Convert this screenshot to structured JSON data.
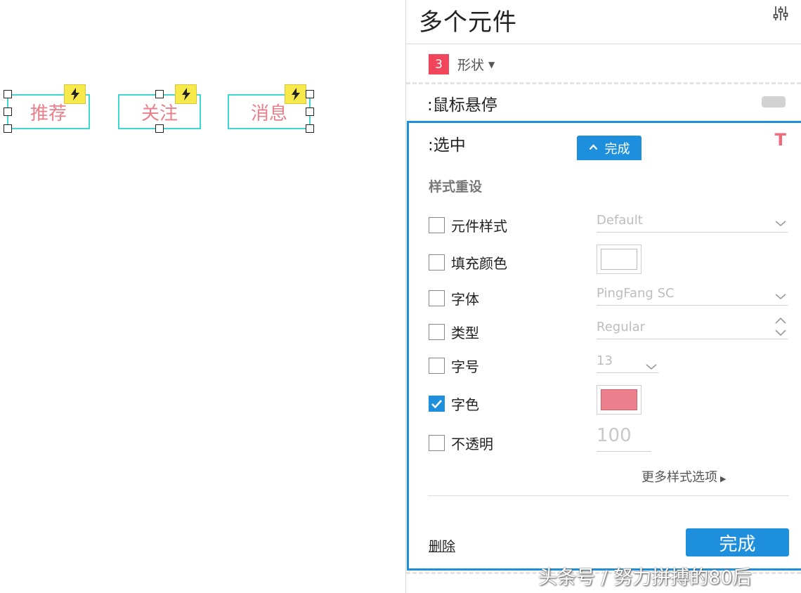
{
  "canvas": {
    "widgets": [
      {
        "label": "推荐"
      },
      {
        "label": "关注"
      },
      {
        "label": "消息"
      }
    ],
    "interaction_icon": "lightning-icon"
  },
  "panel": {
    "title": "多个元件",
    "settings_icon": "sliders-icon",
    "selection_count": "3",
    "shape_label": "形状",
    "hover_state_label": ":鼠标悬停",
    "selected_state_label": ":选中",
    "done_tab_label": "完成",
    "style_reset_title": "样式重设",
    "properties": [
      {
        "label": "元件样式",
        "checked": false,
        "value": "Default"
      },
      {
        "label": "填充颜色",
        "checked": false,
        "value": "#ffffff"
      },
      {
        "label": "字体",
        "checked": false,
        "value": "PingFang SC"
      },
      {
        "label": "类型",
        "checked": false,
        "value": "Regular"
      },
      {
        "label": "字号",
        "checked": false,
        "value": "13"
      },
      {
        "label": "字色",
        "checked": true,
        "value": "#ec808d"
      },
      {
        "label": "不透明",
        "checked": false,
        "value": "100"
      }
    ],
    "more_options_label": "更多样式选项",
    "delete_label": "删除",
    "done_button_label": "完成"
  },
  "colors": {
    "accent": "#1e8fdc",
    "badge": "#f0455b",
    "widget_text": "#e97f8a",
    "widget_border": "#3fd6d2",
    "interaction_badge": "#f7e94a"
  },
  "watermark": "头条号 / 努力拼搏的80后"
}
